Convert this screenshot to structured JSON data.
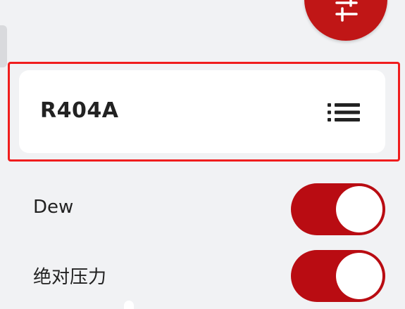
{
  "refrigerant": {
    "name": "R404A"
  },
  "settings": [
    {
      "label": "Dew",
      "enabled": true
    },
    {
      "label": "绝对压力",
      "enabled": true
    }
  ],
  "colors": {
    "accent": "#c01616",
    "toggle_on": "#b90c12",
    "highlight": "#f01d1d",
    "background": "#f1f2f4"
  },
  "icons": {
    "fab": "sliders-icon",
    "card": "list-icon"
  }
}
